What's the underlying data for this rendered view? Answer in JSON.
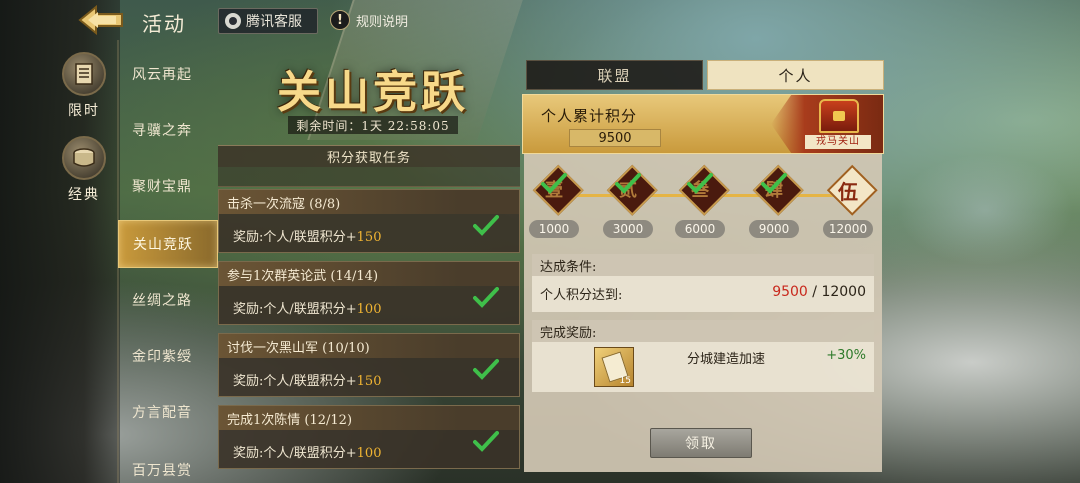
{
  "header": {
    "title": "活动",
    "service_label": "腾讯客服",
    "rules_label": "规则说明"
  },
  "categories": [
    {
      "label": "限时",
      "icon": "scroll-icon"
    },
    {
      "label": "经典",
      "icon": "drum-icon"
    }
  ],
  "activities": [
    {
      "label": "风云再起",
      "active": false
    },
    {
      "label": "寻骥之奔",
      "active": false
    },
    {
      "label": "聚财宝鼎",
      "active": false
    },
    {
      "label": "关山竞跃",
      "active": true
    },
    {
      "label": "丝绸之路",
      "active": false
    },
    {
      "label": "金印紫绶",
      "active": false
    },
    {
      "label": "方言配音",
      "active": false
    },
    {
      "label": "百万县赏",
      "active": false
    }
  ],
  "event": {
    "title": "关山竞跃",
    "time_remaining": "剩余时间：1天 22:58:05"
  },
  "tasks": {
    "header": "积分获取任务",
    "items": [
      {
        "title": "击杀一次流寇 (8/8)",
        "reward_prefix": "奖励:个人/联盟积分+",
        "reward_value": "150",
        "completed": true
      },
      {
        "title": "参与1次群英论武 (14/14)",
        "reward_prefix": "奖励:个人/联盟积分+",
        "reward_value": "100",
        "completed": true
      },
      {
        "title": "讨伐一次黑山军 (10/10)",
        "reward_prefix": "奖励:个人/联盟积分+",
        "reward_value": "150",
        "completed": true
      },
      {
        "title": "完成1次陈情 (12/12)",
        "reward_prefix": "奖励:个人/联盟积分+",
        "reward_value": "100",
        "completed": true
      }
    ]
  },
  "tabs": [
    {
      "label": "联盟",
      "selected": false
    },
    {
      "label": "个人",
      "selected": true
    }
  ],
  "personal": {
    "score_label": "个人累计积分",
    "score_value": "9500",
    "badge_label": "戎马关山",
    "milestones": [
      {
        "char": "壹",
        "value": "1000",
        "state": "reached"
      },
      {
        "char": "贰",
        "value": "3000",
        "state": "reached"
      },
      {
        "char": "叁",
        "value": "6000",
        "state": "reached"
      },
      {
        "char": "肆",
        "value": "9000",
        "state": "reached"
      },
      {
        "char": "伍",
        "value": "12000",
        "state": "current"
      }
    ],
    "condition_header": "达成条件:",
    "condition_text": "个人积分达到:",
    "condition_current": "9500",
    "condition_target": "/  12000",
    "reward_header": "完成奖励:",
    "reward_item_count": "15",
    "reward_name": "分城建造加速",
    "reward_pct": "+30%",
    "claim_label": "领取"
  },
  "colors": {
    "accent_gold": "#e5b445",
    "reward_value": "#f1b533",
    "current_score_red": "#c8281c",
    "check_green": "#3fbf4a",
    "reward_green": "#2e7a2a"
  }
}
